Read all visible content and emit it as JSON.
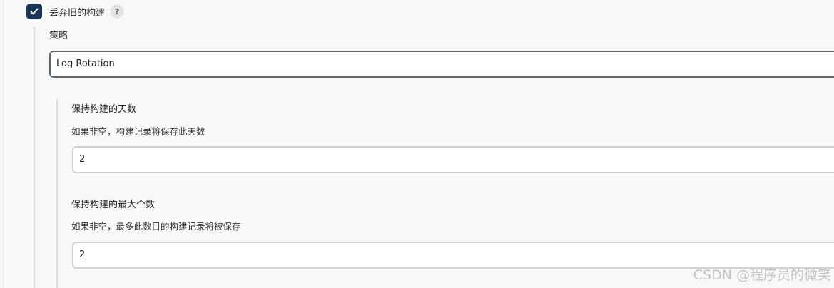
{
  "discard_old_builds": {
    "label": "丢弃旧的构建",
    "checked": true,
    "help": "?"
  },
  "strategy": {
    "label": "策略",
    "value": "Log Rotation"
  },
  "days_to_keep": {
    "title": "保持构建的天数",
    "description": "如果非空，构建记录将保存此天数",
    "value": "2"
  },
  "max_builds": {
    "title": "保持构建的最大个数",
    "description": "如果非空，最多此数目的构建记录将被保存",
    "value": "2"
  },
  "watermark": "CSDN @程序员的微笑",
  "colors": {
    "checkbox": "#1b3658",
    "select_border": "#55697a",
    "input_border": "#d0d0d0",
    "background": "#f8f8f8"
  }
}
